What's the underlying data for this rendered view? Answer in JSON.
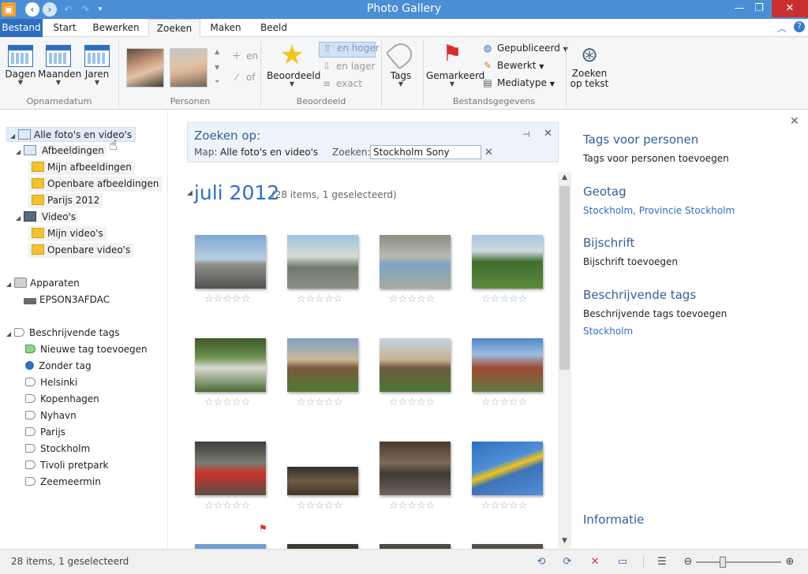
{
  "window": {
    "title": "Photo Gallery"
  },
  "tabs": [
    {
      "label": "Bestand",
      "kind": "file"
    },
    {
      "label": "Start"
    },
    {
      "label": "Bewerken"
    },
    {
      "label": "Zoeken",
      "active": true
    },
    {
      "label": "Maken"
    },
    {
      "label": "Beeld"
    }
  ],
  "ribbon": {
    "opnamedatum": {
      "label": "Opnamedatum",
      "buttons": [
        "Dagen",
        "Maanden",
        "Jaren"
      ]
    },
    "personen": {
      "label": "Personen",
      "add": "en",
      "or": "of"
    },
    "beoordeeld": {
      "label": "Beoordeeld",
      "main": "Beoordeeld",
      "higher": "en hoger",
      "lower": "en lager",
      "exact": "exact"
    },
    "tags": {
      "label": "Tags"
    },
    "bestandsgegevens": {
      "label": "Bestandsgegevens",
      "flagged": "Gemarkeerd",
      "published": "Gepubliceerd",
      "edited": "Bewerkt",
      "mediatype": "Mediatype"
    },
    "textsearch": {
      "line1": "Zoeken",
      "line2": "op tekst"
    }
  },
  "nav": {
    "library_root": "Alle foto's en video's",
    "pictures": "Afbeeldingen",
    "my_pictures": "Mijn afbeeldingen",
    "public_pictures": "Openbare afbeeldingen",
    "paris": "Parijs 2012",
    "videos": "Video's",
    "my_videos": "Mijn video's",
    "public_videos": "Openbare video's",
    "devices": "Apparaten",
    "device_name": "EPSON3AFDAC",
    "tags_header": "Beschrijvende tags",
    "tags": [
      "Nieuwe tag toevoegen",
      "Zonder tag",
      "Helsinki",
      "Kopenhagen",
      "Nyhavn",
      "Parijs",
      "Stockholm",
      "Tivoli pretpark",
      "Zeemeermin"
    ]
  },
  "search": {
    "title": "Zoeken op:",
    "folder_label": "Map:",
    "folder_value": "Alle foto's en video's",
    "query_label": "Zoeken:",
    "query_value": "Stockholm Sony"
  },
  "gallery": {
    "month": "juli 2012",
    "count": "(28 items, 1 geselecteerd)",
    "stars_empty": "☆☆☆☆☆"
  },
  "info_pane": {
    "people_tags_title": "Tags voor personen",
    "people_tags_add": "Tags voor personen toevoegen",
    "geotag_title": "Geotag",
    "geotag_value": "Stockholm, Provincie Stockholm",
    "caption_title": "Bijschrift",
    "caption_add": "Bijschrift toevoegen",
    "desc_tags_title": "Beschrijvende tags",
    "desc_tags_add": "Beschrijvende tags toevoegen",
    "desc_tag_value": "Stockholm",
    "information_title": "Informatie"
  },
  "status": {
    "text": "28 items, 1 geselecteerd",
    "zoom": 0.3
  },
  "colors": {
    "accent": "#2f6fc1",
    "titlebar": "#4a8fd6",
    "close": "#c7302d"
  }
}
